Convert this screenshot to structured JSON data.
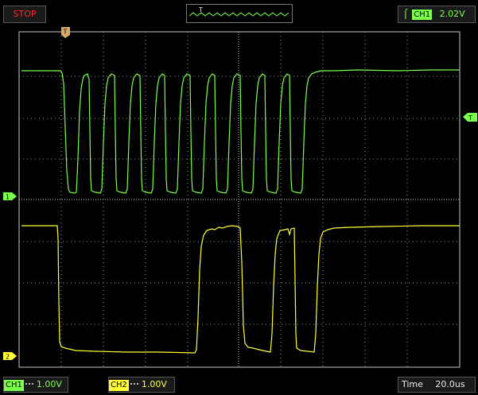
{
  "status": {
    "label": "STOP"
  },
  "trigger": {
    "channel": "CH1",
    "level": "2.02V",
    "marker": "T"
  },
  "channels": [
    {
      "id": "1",
      "name": "CH1",
      "scale": "1.00V",
      "color": "#7aff4a"
    },
    {
      "id": "2",
      "name": "CH2",
      "scale": "1.00V",
      "color": "#ffff33"
    }
  ],
  "timebase": {
    "label": "Time",
    "value": "20.0us"
  },
  "colors": {
    "ch1": "#7aff4a",
    "ch2": "#ffff33",
    "trigger_marker": "#d9a86a",
    "grid": "#c8c8c8",
    "background": "#000000"
  }
}
